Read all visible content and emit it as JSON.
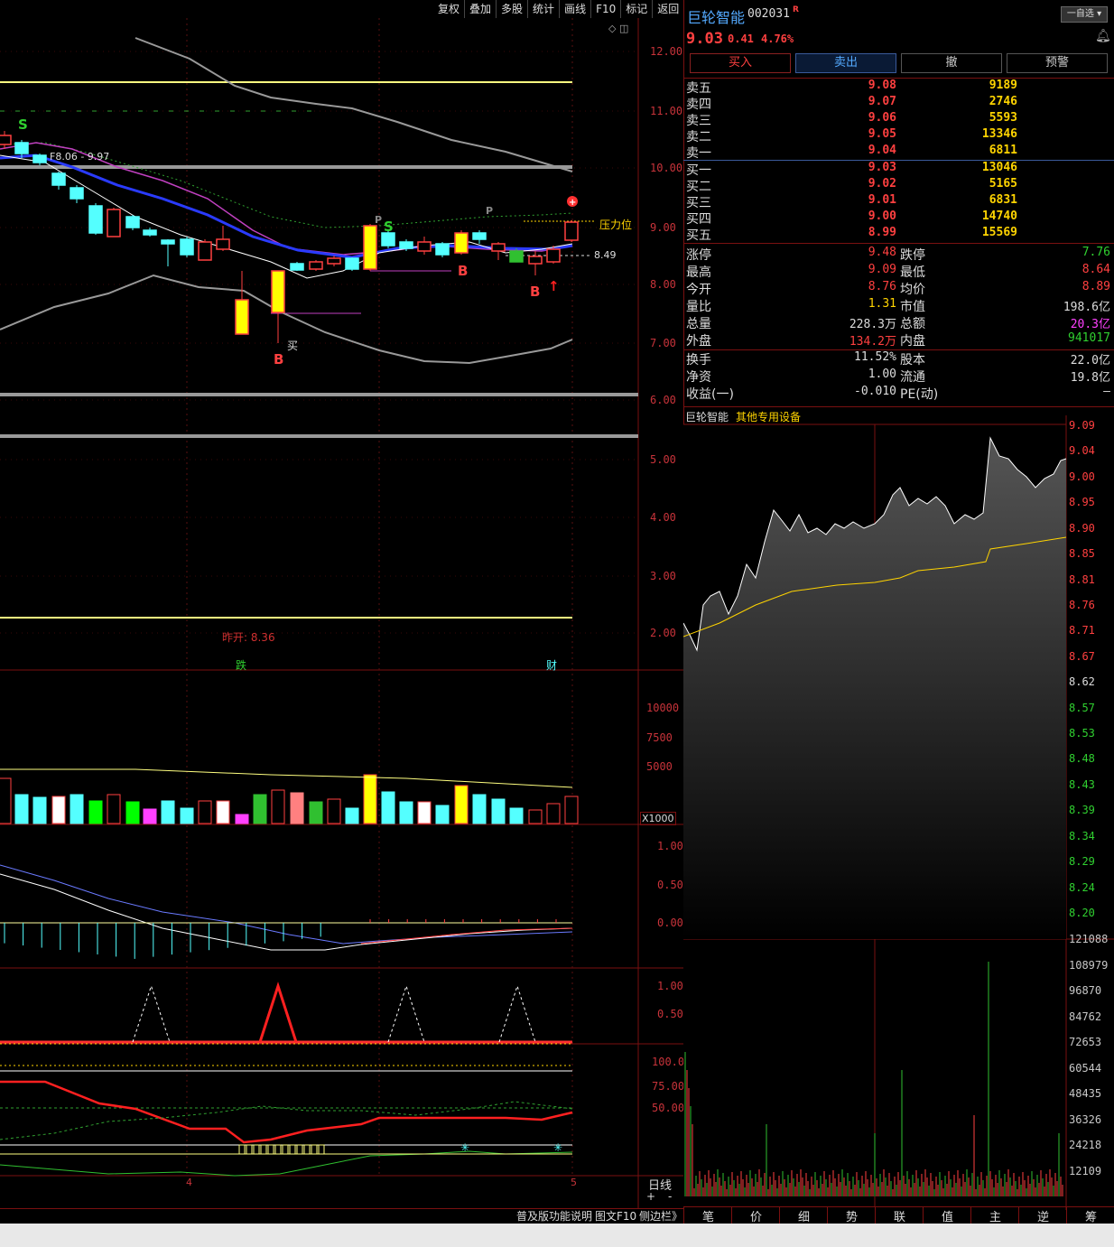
{
  "toolbar": [
    "复权",
    "叠加",
    "多股",
    "统计",
    "画线",
    "F10",
    "标记",
    "返回"
  ],
  "stock": {
    "name": "巨轮智能",
    "code": "002031",
    "flag": "R",
    "price": "9.03",
    "change": "0.41",
    "pct": "4.76%",
    "zixuan": "一自选",
    "industry": "其他专用设备"
  },
  "buttons": {
    "buy": "买入",
    "sell": "卖出",
    "cancel": "撤",
    "alert": "预警"
  },
  "order_book": {
    "asks": [
      {
        "n": "卖五",
        "p": "9.08",
        "v": "9189"
      },
      {
        "n": "卖四",
        "p": "9.07",
        "v": "2746"
      },
      {
        "n": "卖三",
        "p": "9.06",
        "v": "5593"
      },
      {
        "n": "卖二",
        "p": "9.05",
        "v": "13346"
      },
      {
        "n": "卖一",
        "p": "9.04",
        "v": "6811"
      }
    ],
    "bids": [
      {
        "n": "买一",
        "p": "9.03",
        "v": "13046"
      },
      {
        "n": "买二",
        "p": "9.02",
        "v": "5165"
      },
      {
        "n": "买三",
        "p": "9.01",
        "v": "6831"
      },
      {
        "n": "买四",
        "p": "9.00",
        "v": "14740"
      },
      {
        "n": "买五",
        "p": "8.99",
        "v": "15569"
      }
    ]
  },
  "stats": [
    {
      "a": "涨停",
      "av": "9.48",
      "b": "跌停",
      "bv": "7.76",
      "ac": "#ff4040",
      "bc": "#30d030"
    },
    {
      "a": "最高",
      "av": "9.09",
      "b": "最低",
      "bv": "8.64",
      "ac": "#ff4040",
      "bc": "#ff4040"
    },
    {
      "a": "今开",
      "av": "8.76",
      "b": "均价",
      "bv": "8.89",
      "ac": "#ff4040",
      "bc": "#ff4040"
    },
    {
      "a": "量比",
      "av": "1.31",
      "b": "市值",
      "bv": "198.6亿",
      "ac": "#ffd400",
      "bc": "#dddddd"
    },
    {
      "a": "总量",
      "av": "228.3万",
      "b": "总额",
      "bv": "20.3亿",
      "ac": "#dddddd",
      "bc": "#ff40ff"
    },
    {
      "a": "外盘",
      "av": "134.2万",
      "b": "内盘",
      "bv": "941017",
      "ac": "#ff4040",
      "bc": "#30d030"
    }
  ],
  "stats2": [
    {
      "a": "换手",
      "av": "11.52%",
      "b": "股本",
      "bv": "22.0亿"
    },
    {
      "a": "净资",
      "av": "1.00",
      "b": "流通",
      "bv": "19.8亿"
    },
    {
      "a": "收益(一)",
      "av": "-0.010",
      "b": "PE(动)",
      "bv": "—"
    }
  ],
  "kline": {
    "price_axis": [
      "12.00",
      "11.00",
      "10.00",
      "9.00",
      "8.00",
      "7.00",
      "6.00",
      "5.00",
      "4.00",
      "3.00",
      "2.00"
    ],
    "ma_label": "F8.06 - 9.97",
    "pressure": "压力位",
    "line_level": "8.49",
    "yesterday_open": "昨开: 8.36",
    "buy": "买",
    "signals": [
      "S",
      "S",
      "P",
      "P",
      "B",
      "B",
      "B"
    ],
    "markers": [
      "跌",
      "财"
    ],
    "vol_axis": [
      "10000",
      "7500",
      "5000"
    ],
    "vol_unit": "X1000",
    "macd_axis": [
      "1.00",
      "0.50",
      "0.00"
    ],
    "sig_axis": [
      "1.00",
      "0.50"
    ],
    "kdj_axis": [
      "100.0",
      "75.00",
      "50.00"
    ],
    "dates": [
      "4",
      "5"
    ],
    "period": "日线"
  },
  "intraday": {
    "price_axis": [
      "9.09",
      "9.04",
      "9.00",
      "8.95",
      "8.90",
      "8.85",
      "8.81",
      "8.76",
      "8.71",
      "8.67",
      "8.62",
      "8.57",
      "8.53",
      "8.48",
      "8.43",
      "8.39",
      "8.34",
      "8.29",
      "8.24",
      "8.20"
    ],
    "vol_axis": [
      "121088",
      "108979",
      "96870",
      "84762",
      "72653",
      "60544",
      "48435",
      "36326",
      "24218",
      "12109"
    ]
  },
  "status_bar": {
    "help": "普及版功能说明",
    "f10": "图文F10",
    "side": "侧边栏》",
    "plus": "+",
    "minus": "-"
  },
  "nav_tabs": [
    "笔",
    "价",
    "细",
    "势",
    "联",
    "值",
    "主",
    "逆",
    "筹"
  ],
  "colors": {
    "up": "#ff4040",
    "down": "#54ffff",
    "ma5": "#ffffff",
    "ma10": "#2a3bff",
    "ma20": "#c040c0",
    "frame": "#7a1010"
  }
}
